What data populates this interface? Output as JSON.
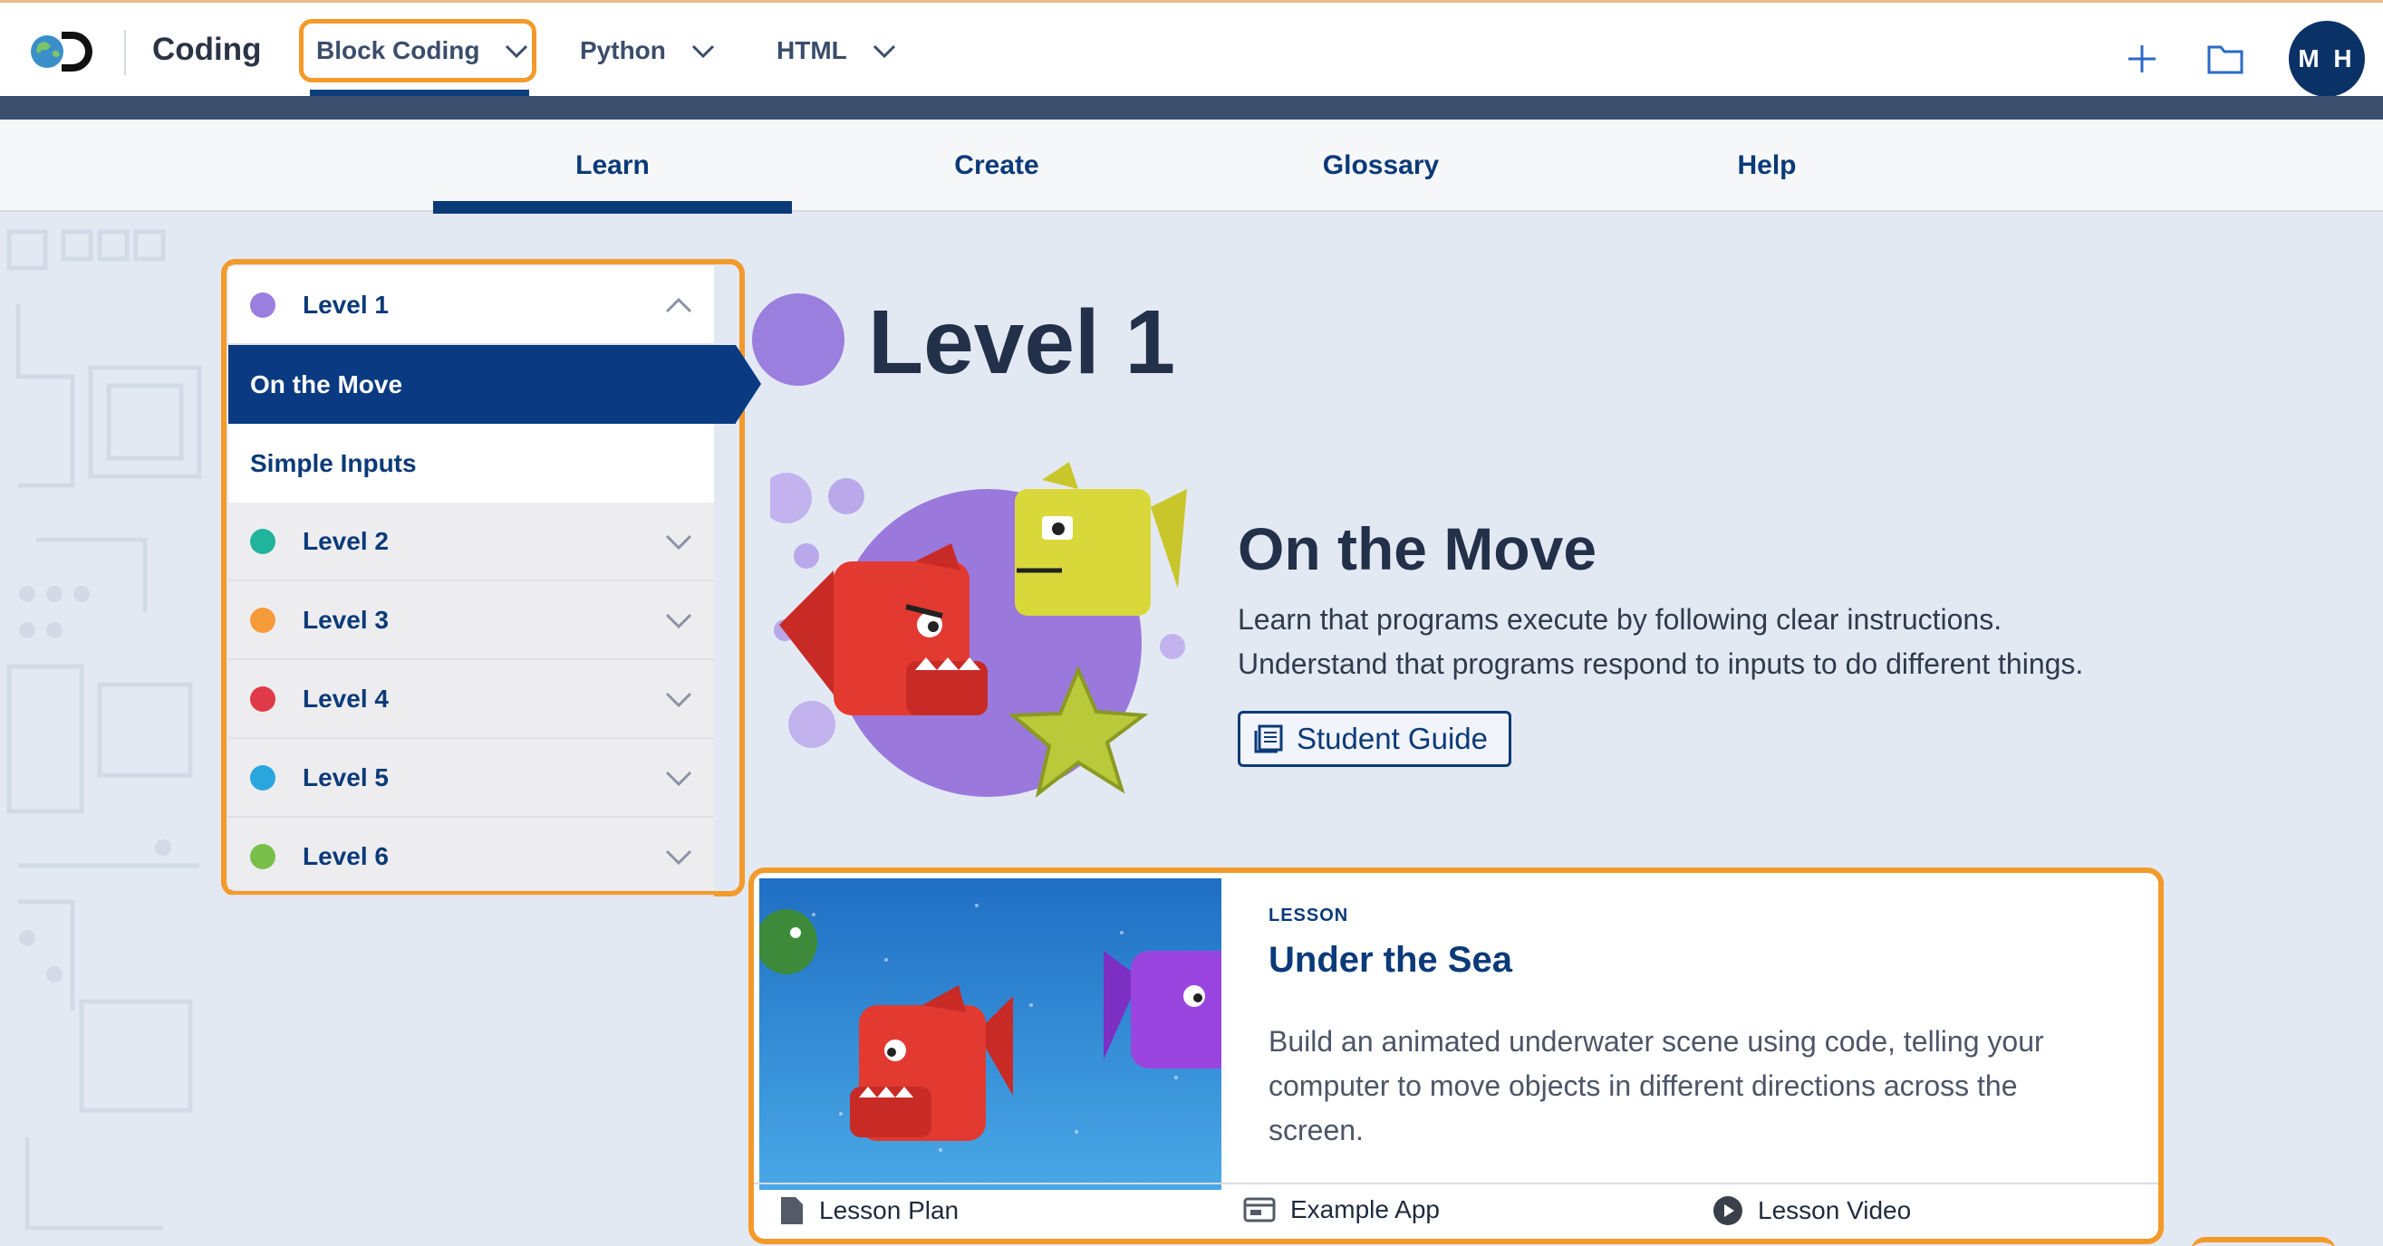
{
  "header": {
    "app_title": "Coding",
    "nav": [
      {
        "label": "Block Coding"
      },
      {
        "label": "Python"
      },
      {
        "label": "HTML"
      }
    ],
    "avatar_initials": "M H",
    "icons": [
      "discovery-logo",
      "plus-icon",
      "folder-icon"
    ]
  },
  "tabs": [
    {
      "label": "Learn",
      "active": true
    },
    {
      "label": "Create",
      "active": false
    },
    {
      "label": "Glossary",
      "active": false
    },
    {
      "label": "Help",
      "active": false
    }
  ],
  "sidebar": {
    "levels": [
      {
        "label": "Level 1",
        "color": "#9a7fde",
        "expanded": true,
        "items": [
          {
            "label": "On the Move",
            "active": true
          },
          {
            "label": "Simple Inputs",
            "active": false
          }
        ]
      },
      {
        "label": "Level 2",
        "color": "#21b39c",
        "expanded": false
      },
      {
        "label": "Level 3",
        "color": "#f59b3a",
        "expanded": false
      },
      {
        "label": "Level 4",
        "color": "#e03a48",
        "expanded": false
      },
      {
        "label": "Level 5",
        "color": "#2aa6df",
        "expanded": false
      },
      {
        "label": "Level 6",
        "color": "#79c04b",
        "expanded": false
      }
    ]
  },
  "main": {
    "level_title": "Level 1",
    "level_color": "#9a7fde",
    "unit_title": "On the Move",
    "unit_desc": [
      "Learn that programs execute by following clear instructions.",
      "Understand that programs respond to inputs to do different things."
    ],
    "guide_button": "Student Guide",
    "lesson": {
      "eyebrow": "LESSON",
      "title": "Under the Sea",
      "description": "Build an animated underwater scene using code, telling your computer to move objects in different directions across the screen.",
      "links": [
        "Lesson Plan",
        "Example App",
        "Lesson Video"
      ]
    }
  },
  "colors": {
    "accent_orange": "#f39a2b",
    "navy": "#0b3a78"
  }
}
